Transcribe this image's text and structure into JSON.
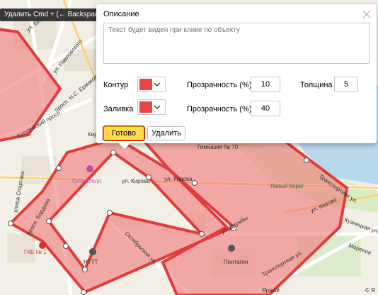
{
  "tooltip": {
    "text": "Удалить Cmd + (← Backspace)"
  },
  "editor": {
    "title": "Описание",
    "description_placeholder": "Текст будет виден при клике по объекту",
    "stroke": {
      "label": "Контур",
      "color": "#ee4444",
      "opacity_label": "Прозрачность (%)",
      "opacity": "10",
      "width_label": "Толщина",
      "width": "5"
    },
    "fill": {
      "label": "Заливка",
      "color": "#ee4444",
      "opacity_label": "Прозрачность (%)",
      "opacity": "40"
    },
    "buttons": {
      "ready": "Готово",
      "delete": "Удалить"
    }
  },
  "map": {
    "polygon_stroke": "#e23b3b",
    "polygon_fill": "#f07878",
    "street_labels": [
      "ул. Белана",
      "ул. Павловского",
      "просп. Н.С. Ермакова",
      "Кутузовский просп.",
      "Кирова",
      "Сити Молл",
      "ул. Кирова",
      "ул. Кирова",
      "Гимназия № 70",
      "улица Спартака",
      "просп. Бардина",
      "ул. Дружбы",
      "Октябрьская ул.",
      "Транспортная ул.",
      "НТТТ",
      "Пентагон",
      "ГКБ № 1",
      "Транспортная ул.",
      "ул. Кирова",
      "Левый берег",
      "Кузнецкая ул.",
      "Мореное",
      "Ярный",
      "© Я"
    ]
  }
}
